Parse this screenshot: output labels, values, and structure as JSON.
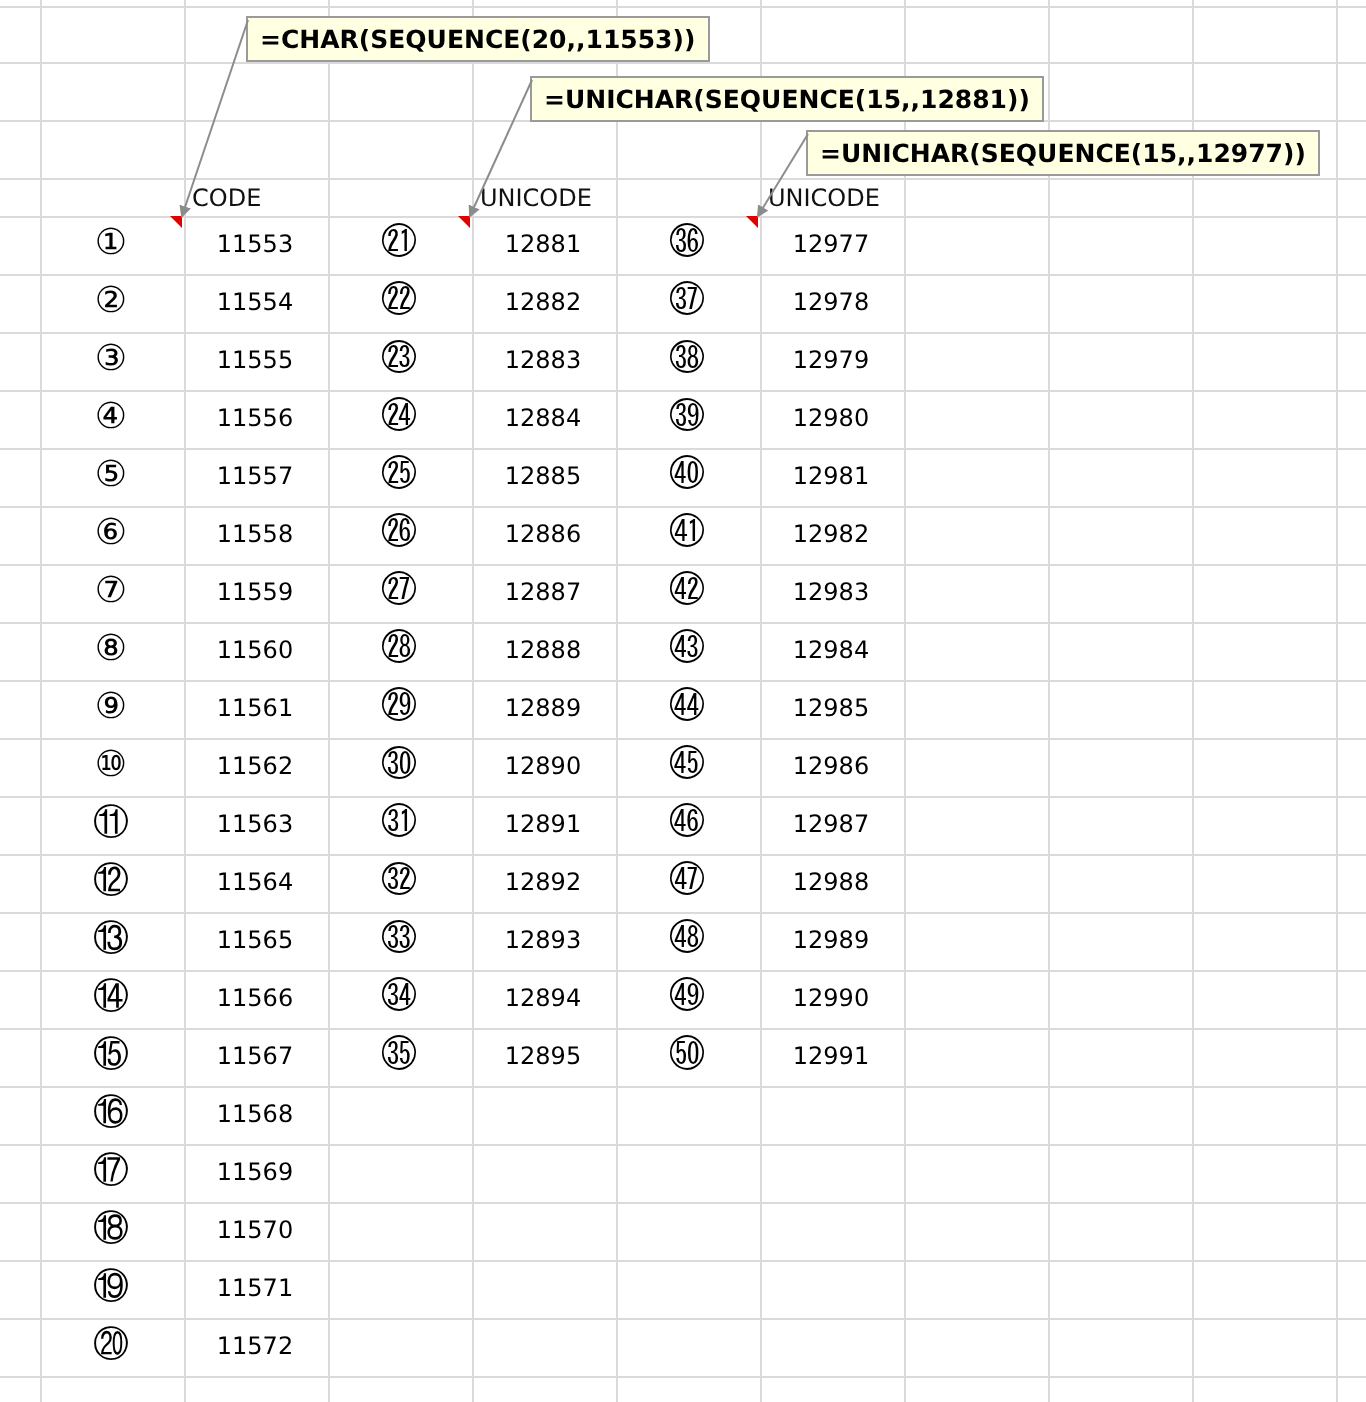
{
  "comments": [
    {
      "text": "=CHAR(SEQUENCE(20,,11553))"
    },
    {
      "text": "=UNICHAR(SEQUENCE(15,,12881))"
    },
    {
      "text": "=UNICHAR(SEQUENCE(15,,12977))"
    }
  ],
  "blocks": [
    {
      "header": "CODE",
      "rows": [
        {
          "char": "①",
          "code": "11553"
        },
        {
          "char": "②",
          "code": "11554"
        },
        {
          "char": "③",
          "code": "11555"
        },
        {
          "char": "④",
          "code": "11556"
        },
        {
          "char": "⑤",
          "code": "11557"
        },
        {
          "char": "⑥",
          "code": "11558"
        },
        {
          "char": "⑦",
          "code": "11559"
        },
        {
          "char": "⑧",
          "code": "11560"
        },
        {
          "char": "⑨",
          "code": "11561"
        },
        {
          "char": "⑩",
          "code": "11562"
        },
        {
          "char": "⑪",
          "code": "11563"
        },
        {
          "char": "⑫",
          "code": "11564"
        },
        {
          "char": "⑬",
          "code": "11565"
        },
        {
          "char": "⑭",
          "code": "11566"
        },
        {
          "char": "⑮",
          "code": "11567"
        },
        {
          "char": "⑯",
          "code": "11568"
        },
        {
          "char": "⑰",
          "code": "11569"
        },
        {
          "char": "⑱",
          "code": "11570"
        },
        {
          "char": "⑲",
          "code": "11571"
        },
        {
          "char": "⑳",
          "code": "11572"
        }
      ]
    },
    {
      "header": "UNICODE",
      "rows": [
        {
          "char": "㉑",
          "code": "12881"
        },
        {
          "char": "㉒",
          "code": "12882"
        },
        {
          "char": "㉓",
          "code": "12883"
        },
        {
          "char": "㉔",
          "code": "12884"
        },
        {
          "char": "㉕",
          "code": "12885"
        },
        {
          "char": "㉖",
          "code": "12886"
        },
        {
          "char": "㉗",
          "code": "12887"
        },
        {
          "char": "㉘",
          "code": "12888"
        },
        {
          "char": "㉙",
          "code": "12889"
        },
        {
          "char": "㉚",
          "code": "12890"
        },
        {
          "char": "㉛",
          "code": "12891"
        },
        {
          "char": "㉜",
          "code": "12892"
        },
        {
          "char": "㉝",
          "code": "12893"
        },
        {
          "char": "㉞",
          "code": "12894"
        },
        {
          "char": "㉟",
          "code": "12895"
        }
      ]
    },
    {
      "header": "UNICODE",
      "rows": [
        {
          "char": "㊱",
          "code": "12977"
        },
        {
          "char": "㊲",
          "code": "12978"
        },
        {
          "char": "㊳",
          "code": "12979"
        },
        {
          "char": "㊴",
          "code": "12980"
        },
        {
          "char": "㊵",
          "code": "12981"
        },
        {
          "char": "㊶",
          "code": "12982"
        },
        {
          "char": "㊷",
          "code": "12983"
        },
        {
          "char": "㊸",
          "code": "12984"
        },
        {
          "char": "㊹",
          "code": "12985"
        },
        {
          "char": "㊺",
          "code": "12986"
        },
        {
          "char": "㊻",
          "code": "12987"
        },
        {
          "char": "㊼",
          "code": "12988"
        },
        {
          "char": "㊽",
          "code": "12989"
        },
        {
          "char": "㊾",
          "code": "12990"
        },
        {
          "char": "㊿",
          "code": "12991"
        }
      ]
    }
  ]
}
